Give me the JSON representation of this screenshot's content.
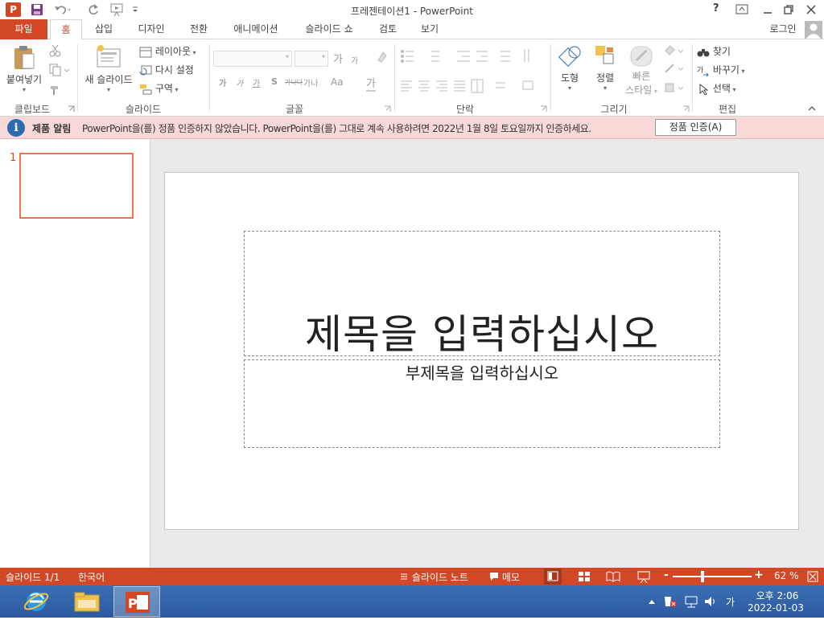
{
  "app": {
    "title": "프레젠테이션1 - PowerPoint",
    "icon_letter": "P"
  },
  "title_buttons": {
    "help": "?"
  },
  "tabs": {
    "file": "파일",
    "home": "홈",
    "insert": "삽입",
    "design": "디자인",
    "transitions": "전환",
    "animations": "애니메이션",
    "slideshow": "슬라이드 쇼",
    "review": "검토",
    "view": "보기",
    "login": "로그인"
  },
  "ribbon": {
    "paste": "붙여넣기",
    "new_slide": "새 슬라이드",
    "layout": "레이아웃",
    "reset": "다시 설정",
    "section": "구역",
    "find": "찾기",
    "replace": "바꾸기",
    "select": "선택",
    "shapes": "도형",
    "arrange": "정렬",
    "quick_styles_1": "빠른",
    "quick_styles_2": "스타일",
    "font_a1": "가",
    "font_a2": "가",
    "font_fmt": [
      "가",
      "가",
      "가",
      "S",
      "가나다",
      "가나",
      "Aa",
      "가"
    ],
    "groups": {
      "clipboard": "클립보드",
      "slides": "슬라이드",
      "font": "글꼴",
      "paragraph": "단락",
      "drawing": "그리기",
      "editing": "편집"
    }
  },
  "message_bar": {
    "title": "제품 알림",
    "text": "PowerPoint을(를) 정품 인증하지 않았습니다. PowerPoint을(를) 그대로 계속 사용하려면 2022년 1월 8일 토요일까지 인증하세요.",
    "button": "정품 인증(A)"
  },
  "thumbnails": [
    {
      "number": "1"
    }
  ],
  "slide": {
    "title_placeholder": "제목을 입력하십시오",
    "subtitle_placeholder": "부제목을 입력하십시오"
  },
  "status": {
    "slide_count": "슬라이드 1/1",
    "language": "한국어",
    "notes": "슬라이드 노트",
    "comments": "메모",
    "zoom_minus": "-",
    "zoom_plus": "+",
    "zoom": "62 %",
    "zoom_level": 0.38
  },
  "taskbar": {
    "time": "오후 2:06",
    "date": "2022-01-03",
    "ime": "가"
  },
  "colors": {
    "accent": "#d24726",
    "status_bg": "#d24726",
    "msg_bg": "#f9d8d8",
    "taskbar": "#2c5aa0"
  }
}
